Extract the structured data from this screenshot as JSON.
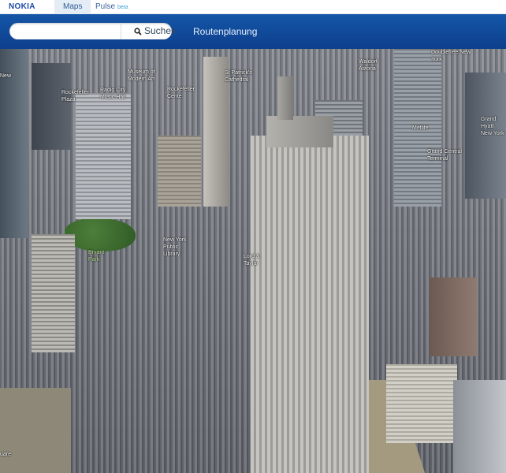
{
  "brand": {
    "logo": "NOKIA"
  },
  "tabs": [
    {
      "label": "Maps",
      "active": true
    },
    {
      "label": "Pulse",
      "badge": "beta",
      "active": false
    }
  ],
  "search": {
    "value": "",
    "placeholder": "",
    "button_label": "Suchen"
  },
  "nav": {
    "route_link": "Routenplanung"
  },
  "colors": {
    "header": "#1556a8",
    "logo": "#1b4aa8",
    "tab_active_bg": "#e4ecf5"
  },
  "map": {
    "pois": [
      {
        "id": "new",
        "label": "New"
      },
      {
        "id": "rockefeller-plaza",
        "label": "Rockefeller Plaza"
      },
      {
        "id": "radio-city",
        "label": "Radio City Music Hall"
      },
      {
        "id": "moma",
        "label": "Museum of Modern Art"
      },
      {
        "id": "rockefeller-cente",
        "label": "Rockefeller Cente"
      },
      {
        "id": "st-patricks",
        "label": "St Patrick's Cathedral"
      },
      {
        "id": "waldorf",
        "label": "Waldorf Astoria"
      },
      {
        "id": "doubletree",
        "label": "Doubletree New York"
      },
      {
        "id": "metlife",
        "label": "Metlife"
      },
      {
        "id": "grand-hyatt",
        "label": "Grand Hyatt New York"
      },
      {
        "id": "grand-central",
        "label": "Grand Central Terminal"
      },
      {
        "id": "bryant-park",
        "label": "Bryant Park"
      },
      {
        "id": "nypl",
        "label": "New York Public Library"
      },
      {
        "id": "lord-taylor",
        "label": "Lord & Taylor"
      },
      {
        "id": "square",
        "label": "uare"
      }
    ]
  }
}
